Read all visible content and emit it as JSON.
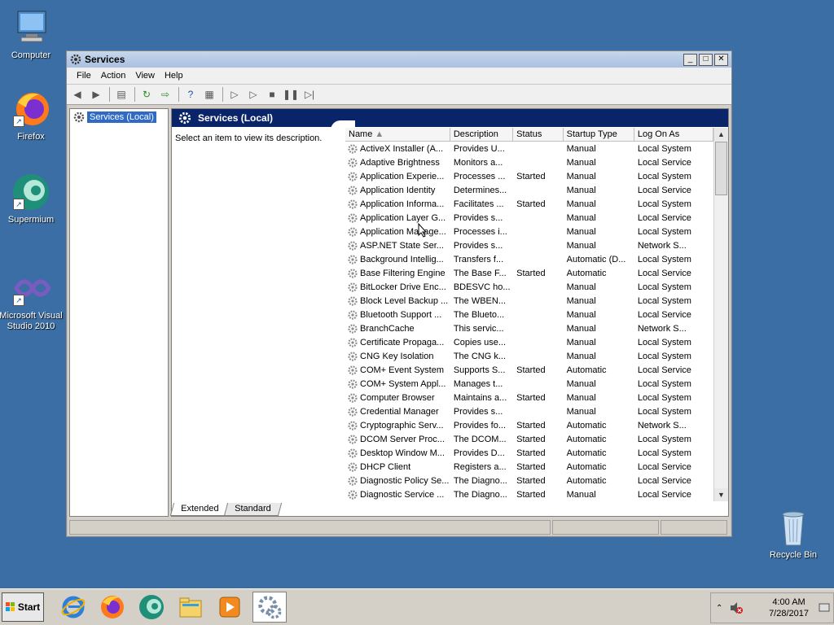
{
  "desktop": {
    "icons": [
      {
        "label": "Computer"
      },
      {
        "label": "Firefox"
      },
      {
        "label": "Supermium"
      },
      {
        "label": "Microsoft Visual Studio 2010"
      },
      {
        "label": "Recycle Bin"
      }
    ]
  },
  "window": {
    "title": "Services",
    "menu": [
      "File",
      "Action",
      "View",
      "Help"
    ],
    "tree_item": "Services (Local)",
    "pane_title": "Services (Local)",
    "description_hint": "Select an item to view its description.",
    "columns": [
      "Name",
      "Description",
      "Status",
      "Startup Type",
      "Log On As"
    ],
    "rows": [
      [
        "ActiveX Installer (A...",
        "Provides U...",
        "",
        "Manual",
        "Local System"
      ],
      [
        "Adaptive Brightness",
        "Monitors a...",
        "",
        "Manual",
        "Local Service"
      ],
      [
        "Application Experie...",
        "Processes ...",
        "Started",
        "Manual",
        "Local System"
      ],
      [
        "Application Identity",
        "Determines...",
        "",
        "Manual",
        "Local Service"
      ],
      [
        "Application Informa...",
        "Facilitates ...",
        "Started",
        "Manual",
        "Local System"
      ],
      [
        "Application Layer G...",
        "Provides s...",
        "",
        "Manual",
        "Local Service"
      ],
      [
        "Application Manage...",
        "Processes i...",
        "",
        "Manual",
        "Local System"
      ],
      [
        "ASP.NET State Ser...",
        "Provides s...",
        "",
        "Manual",
        "Network S..."
      ],
      [
        "Background Intellig...",
        "Transfers f...",
        "",
        "Automatic (D...",
        "Local System"
      ],
      [
        "Base Filtering Engine",
        "The Base F...",
        "Started",
        "Automatic",
        "Local Service"
      ],
      [
        "BitLocker Drive Enc...",
        "BDESVC ho...",
        "",
        "Manual",
        "Local System"
      ],
      [
        "Block Level Backup ...",
        "The WBEN...",
        "",
        "Manual",
        "Local System"
      ],
      [
        "Bluetooth Support ...",
        "The Blueto...",
        "",
        "Manual",
        "Local Service"
      ],
      [
        "BranchCache",
        "This servic...",
        "",
        "Manual",
        "Network S..."
      ],
      [
        "Certificate Propaga...",
        "Copies use...",
        "",
        "Manual",
        "Local System"
      ],
      [
        "CNG Key Isolation",
        "The CNG k...",
        "",
        "Manual",
        "Local System"
      ],
      [
        "COM+ Event System",
        "Supports S...",
        "Started",
        "Automatic",
        "Local Service"
      ],
      [
        "COM+ System Appl...",
        "Manages t...",
        "",
        "Manual",
        "Local System"
      ],
      [
        "Computer Browser",
        "Maintains a...",
        "Started",
        "Manual",
        "Local System"
      ],
      [
        "Credential Manager",
        "Provides s...",
        "",
        "Manual",
        "Local System"
      ],
      [
        "Cryptographic Serv...",
        "Provides fo...",
        "Started",
        "Automatic",
        "Network S..."
      ],
      [
        "DCOM Server Proc...",
        "The DCOM...",
        "Started",
        "Automatic",
        "Local System"
      ],
      [
        "Desktop Window M...",
        "Provides D...",
        "Started",
        "Automatic",
        "Local System"
      ],
      [
        "DHCP Client",
        "Registers a...",
        "Started",
        "Automatic",
        "Local Service"
      ],
      [
        "Diagnostic Policy Se...",
        "The Diagno...",
        "Started",
        "Automatic",
        "Local Service"
      ],
      [
        "Diagnostic Service ...",
        "The Diagno...",
        "Started",
        "Manual",
        "Local Service"
      ]
    ],
    "tabs": [
      "Extended",
      "Standard"
    ]
  },
  "taskbar": {
    "start_label": "Start",
    "time": "4:00 AM",
    "date": "7/28/2017"
  }
}
